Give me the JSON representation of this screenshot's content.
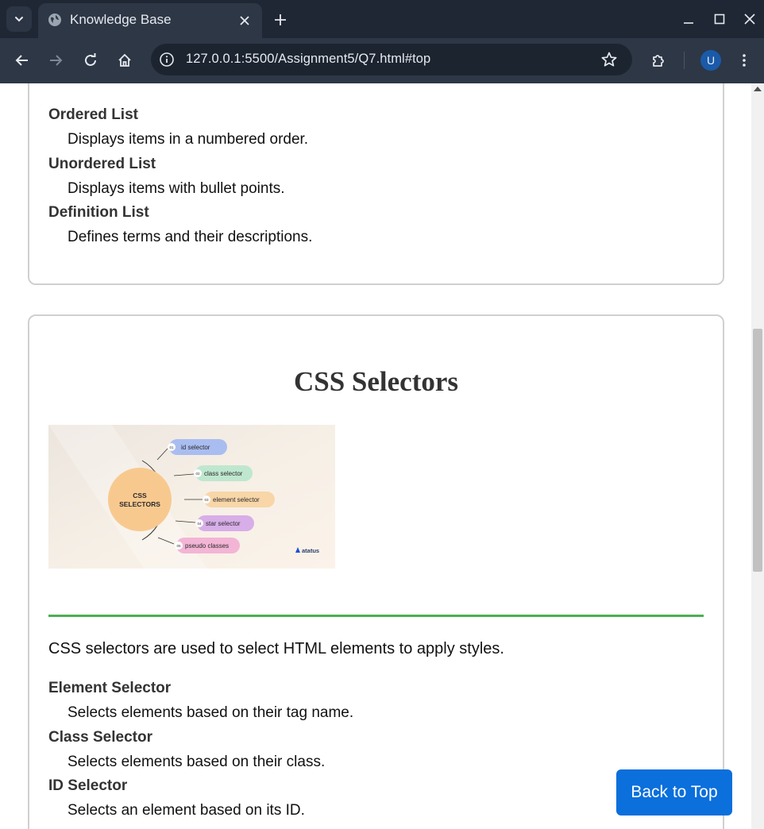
{
  "browser": {
    "tab_title": "Knowledge Base",
    "url": "127.0.0.1:5500/Assignment5/Q7.html#top",
    "avatar_letter": "U"
  },
  "list_section": {
    "items": [
      {
        "term": "Ordered List",
        "description": "Displays items in a numbered order."
      },
      {
        "term": "Unordered List",
        "description": "Displays items with bullet points."
      },
      {
        "term": "Definition List",
        "description": "Defines terms and their descriptions."
      }
    ]
  },
  "css_section": {
    "title": "CSS Selectors",
    "image": {
      "center_label_line1": "CSS",
      "center_label_line2": "SELECTORS",
      "pills": [
        {
          "num": "01",
          "label": "id selector"
        },
        {
          "num": "02",
          "label": "class selector"
        },
        {
          "num": "03",
          "label": "element selector"
        },
        {
          "num": "04",
          "label": "star selector"
        },
        {
          "num": "05",
          "label": "pseudo classes"
        }
      ],
      "brand": "atatus"
    },
    "intro": "CSS selectors are used to select HTML elements to apply styles.",
    "items": [
      {
        "term": "Element Selector",
        "description": "Selects elements based on their tag name."
      },
      {
        "term": "Class Selector",
        "description": "Selects elements based on their class."
      },
      {
        "term": "ID Selector",
        "description": "Selects an element based on its ID."
      }
    ]
  },
  "back_to_top_label": "Back to Top",
  "colors": {
    "accent_rule": "#4caf50",
    "button": "#0b6fdc",
    "pill_id": "#a9bdf0",
    "pill_class": "#bfe7cf",
    "pill_element": "#f8d6a8",
    "pill_star": "#d7aee8",
    "pill_pseudo": "#f3b5d5"
  }
}
